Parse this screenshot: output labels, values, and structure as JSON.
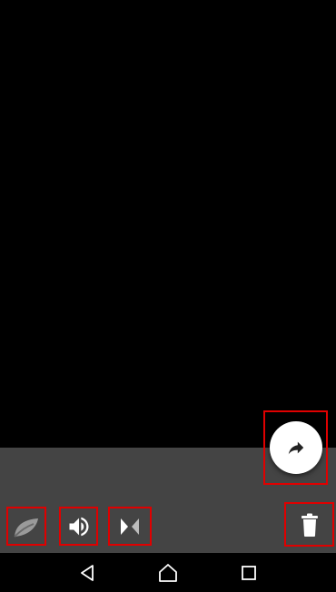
{
  "colors": {
    "background": "#000000",
    "panel": "#444444",
    "highlight": "#e00000",
    "fab": "#ffffff",
    "icon": "#ffffff"
  },
  "icons": {
    "share": "share-arrow-icon",
    "effect": "effect-icon",
    "sound": "volume-icon",
    "mirror": "mirror-icon",
    "delete": "trash-icon",
    "nav_back": "back-triangle-icon",
    "nav_home": "home-icon",
    "nav_recents": "recents-square-icon"
  }
}
